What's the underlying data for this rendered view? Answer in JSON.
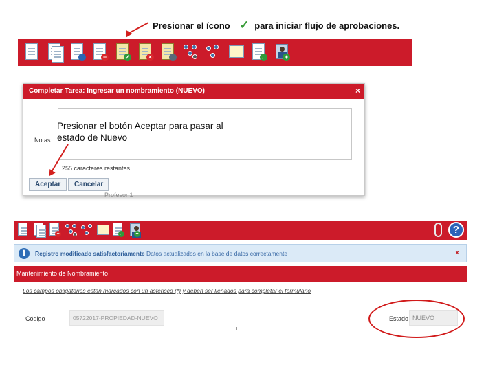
{
  "instruction_top": {
    "before": "Presionar el ícono",
    "check_glyph": "✓",
    "after": "para iniciar flujo de aprobaciones."
  },
  "toolbar_top": {
    "icons": [
      "new-document-icon",
      "copy-document-icon",
      "save-document-icon",
      "delete-document-icon",
      "approve-clipboard-icon",
      "reject-clipboard-icon",
      "clipboard-user-icon",
      "workflow-search-icon",
      "workflow-list-icon",
      "certificate-icon",
      "document-import-icon",
      "add-person-icon"
    ]
  },
  "dialog": {
    "title": "Completar Tarea: Ingresar un nombramiento (NUEVO)",
    "close": "×",
    "notes_label": "Notas",
    "notes_value": "",
    "remaining": "255 caracteres restantes",
    "accept_label": "Aceptar",
    "cancel_label": "Cancelar"
  },
  "instruction_overlay": "Presionar el botón Aceptar para pasar al estado de Nuevo",
  "behind_text": "Profesor 1",
  "toolbar_bottom": {
    "icons": [
      "new-document-icon",
      "copy-document-icon",
      "delete-document-icon",
      "workflow-search-icon",
      "workflow-list-icon",
      "certificate-icon",
      "document-import-icon",
      "add-person-icon"
    ],
    "help": "?"
  },
  "banner": {
    "info": "i",
    "bold": "Registro modificado satisfactoriamente",
    "text": "Datos actualizados en la base de datos correctamente",
    "close": "×"
  },
  "section_title": "Mantenimiento de Nombramiento",
  "required_note": "Los campos obligatorios están marcados con un asterisco (*) y deben ser llenados para completar el formulario",
  "form": {
    "codigo_label": "Código",
    "codigo_value": "05722017-PROPIEDAD-NUEVO",
    "estado_label": "Estado",
    "estado_value": "NUEVO"
  },
  "colors": {
    "brand_red": "#cc1b2a",
    "annotation_red": "#d3201e",
    "info_blue": "#2f6db6",
    "check_green": "#3a9c3a"
  }
}
